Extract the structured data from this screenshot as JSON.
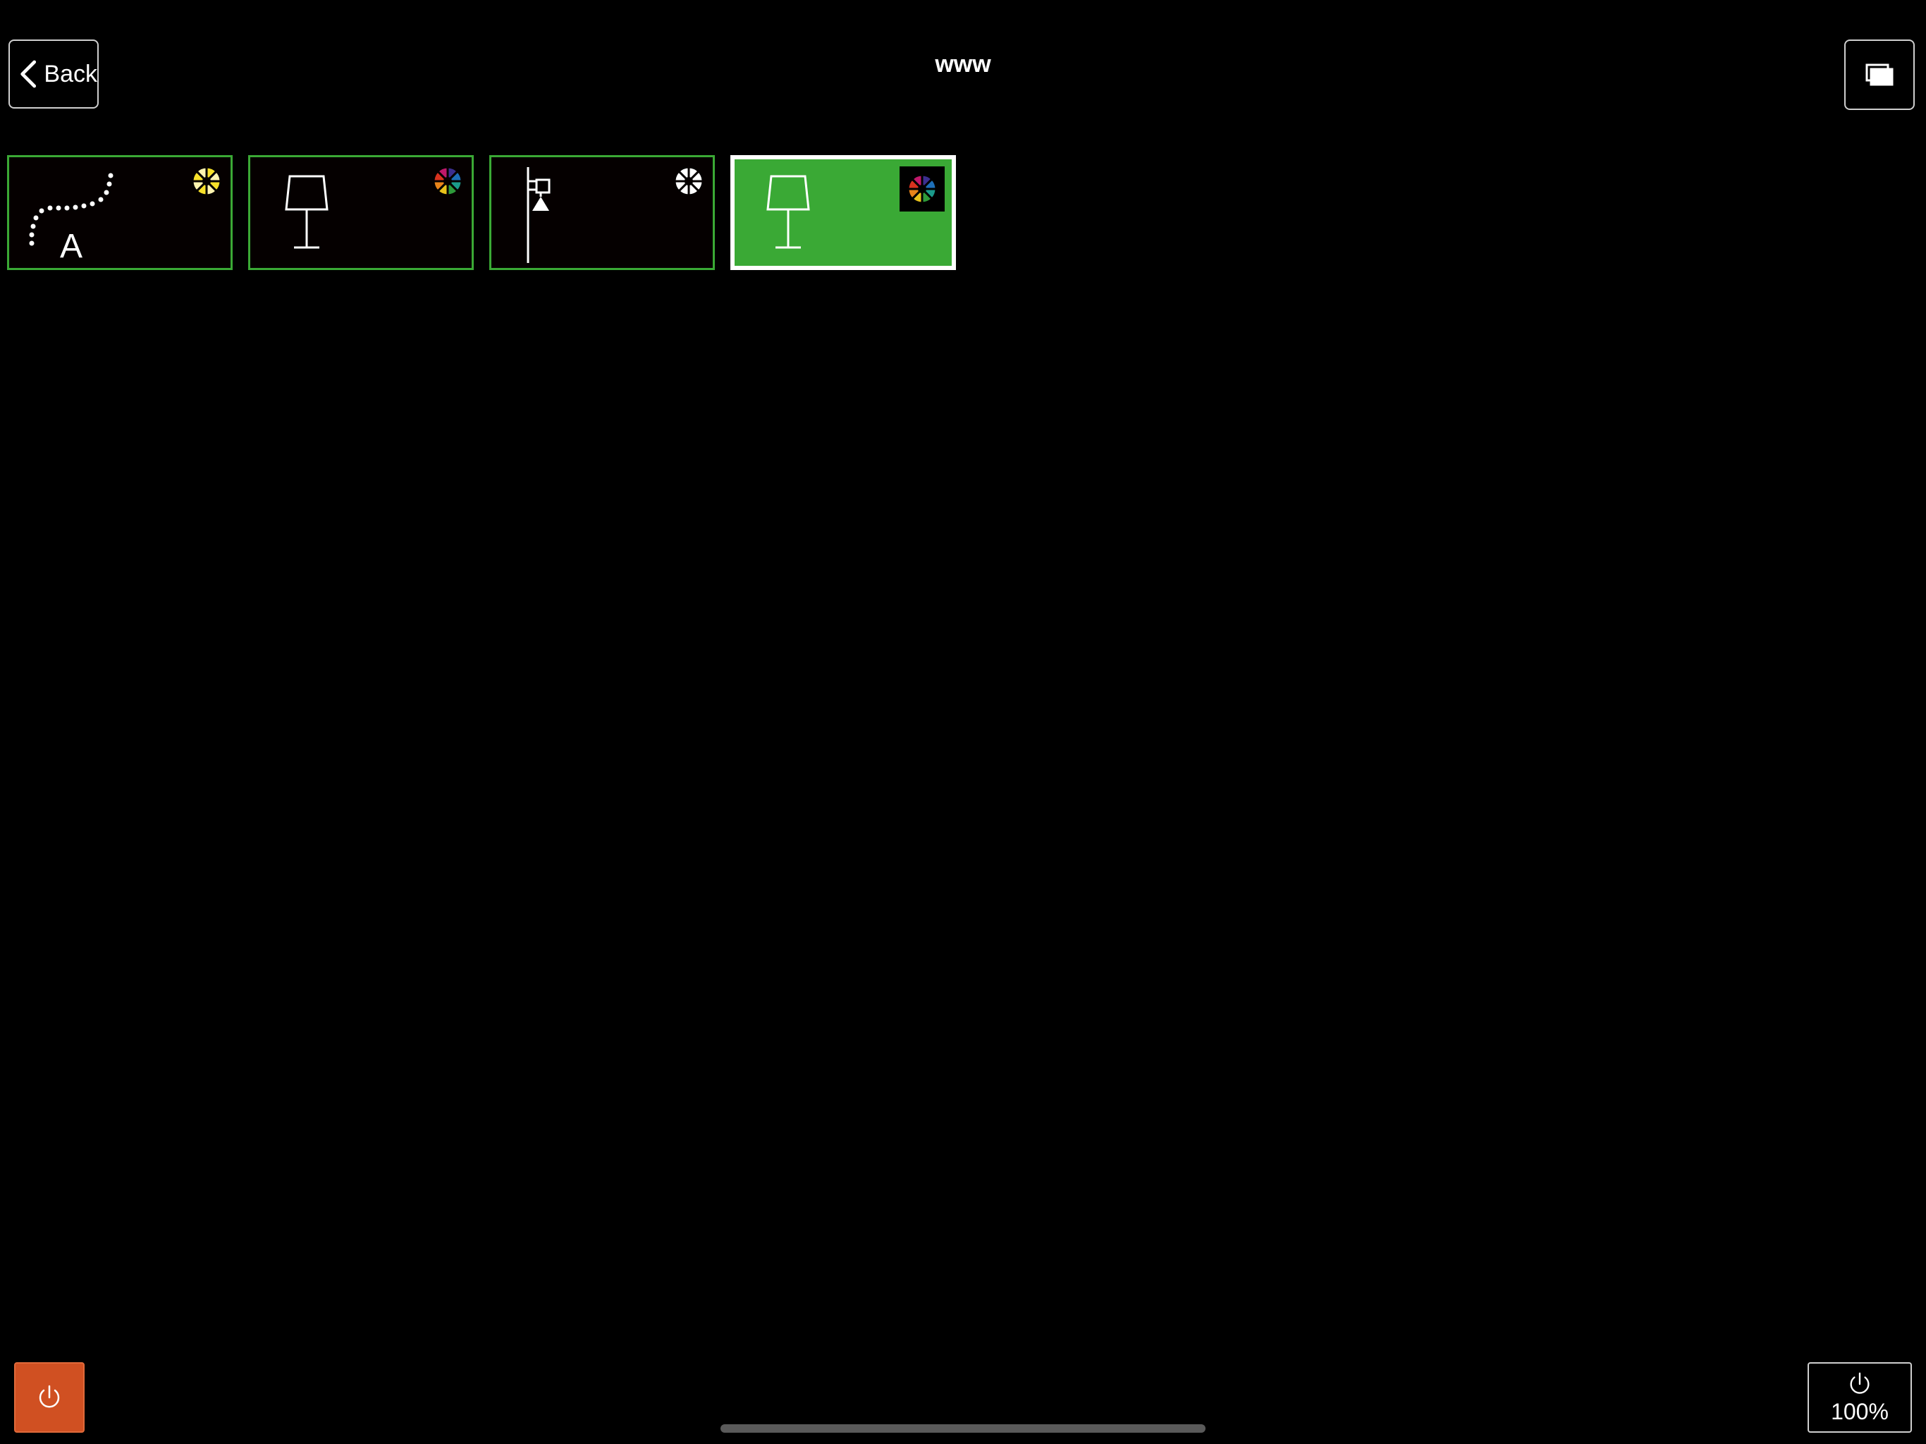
{
  "header": {
    "back_label": "Back",
    "title": "www"
  },
  "tiles": [
    {
      "device": "led-strip-a",
      "badge": "warm-white-wheel",
      "active": false
    },
    {
      "device": "table-lamp",
      "badge": "rgb-wheel",
      "active": false
    },
    {
      "device": "wall-spot",
      "badge": "white-wheel",
      "active": false
    },
    {
      "device": "table-lamp",
      "badge": "rgb-wheel",
      "active": true
    }
  ],
  "footer": {
    "dimmer_value": "100%"
  },
  "colors": {
    "accent_green": "#3aa935",
    "power_orange": "#d05022",
    "background": "#000000"
  }
}
